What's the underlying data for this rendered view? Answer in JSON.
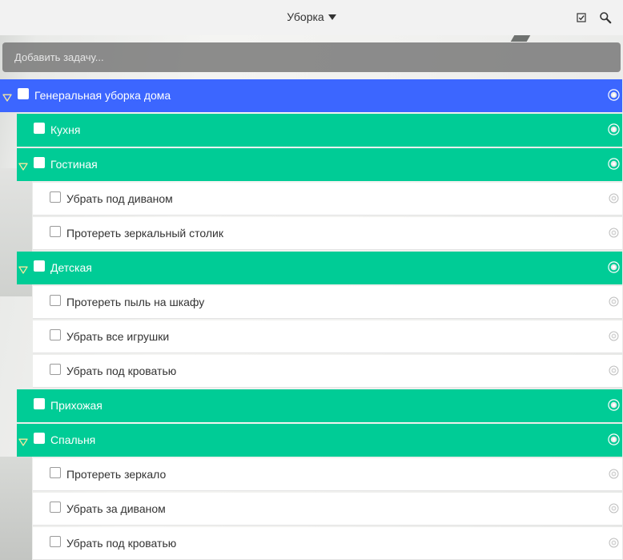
{
  "header": {
    "list_title": "Уборка",
    "icons": [
      "checkbox-toggle-icon",
      "search-icon"
    ]
  },
  "add_task": {
    "placeholder": "Добавить задачу..."
  },
  "colors": {
    "parent_row": "#3c66ff",
    "group_row": "#00cc96",
    "subtask_row": "#ffffff"
  },
  "tasks": [
    {
      "label": "Генеральная уборка дома",
      "level": 0,
      "expandable": true
    },
    {
      "label": "Кухня",
      "level": 1,
      "expandable": false
    },
    {
      "label": "Гостиная",
      "level": 1,
      "expandable": true
    },
    {
      "label": "Убрать под диваном",
      "level": 2,
      "expandable": false
    },
    {
      "label": "Протереть зеркальный столик",
      "level": 2,
      "expandable": false
    },
    {
      "label": "Детская",
      "level": 1,
      "expandable": true
    },
    {
      "label": "Протереть пыль на шкафу",
      "level": 2,
      "expandable": false
    },
    {
      "label": "Убрать все игрушки",
      "level": 2,
      "expandable": false
    },
    {
      "label": "Убрать под кроватью",
      "level": 2,
      "expandable": false
    },
    {
      "label": "Прихожая",
      "level": 1,
      "expandable": false
    },
    {
      "label": "Спальня",
      "level": 1,
      "expandable": true
    },
    {
      "label": "Протереть зеркало",
      "level": 2,
      "expandable": false
    },
    {
      "label": "Убрать за диваном",
      "level": 2,
      "expandable": false
    },
    {
      "label": "Убрать под кроватью",
      "level": 2,
      "expandable": false
    }
  ]
}
